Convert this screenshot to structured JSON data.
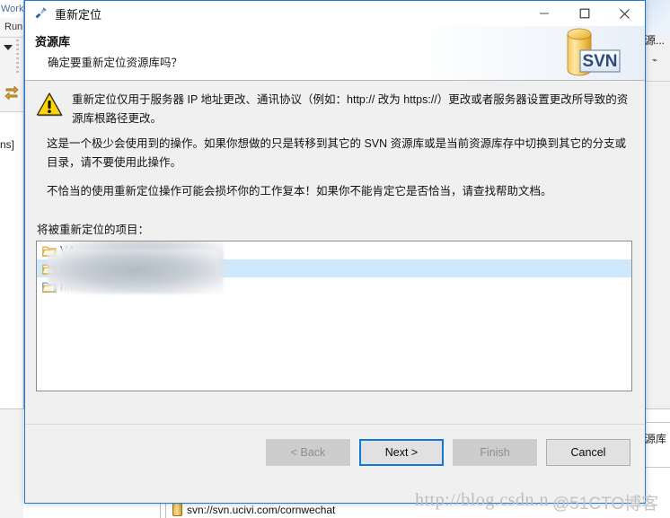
{
  "window": {
    "title": "重新定位",
    "title_icon": "relocate-icon",
    "controls": {
      "minimize": "—",
      "maximize": "□",
      "close": "✕"
    }
  },
  "header": {
    "title": "资源库",
    "subtitle": "确定要重新定位资源库吗？",
    "logo_text": "SVN",
    "logo_name": "svn-repository-logo"
  },
  "body": {
    "warning_icon": "warning-triangle-icon",
    "warning_text": "重新定位仅用于服务器 IP 地址更改、通讯协议（例如：http:// 改为 https://）更改或者服务器设置更改所导致的资源库根路径更改。",
    "paragraph_2": "这是一个极少会使用到的操作。如果你想做的只是转移到其它的 SVN 资源库或是当前资源库存中切换到其它的分支或目录，请不要使用此操作。",
    "paragraph_3": "不恰当的使用重新定位操作可能会损坏你的工作复本！如果你不能肯定它是否恰当，请查找帮助文档。"
  },
  "list": {
    "label": "将被重新定位的项目：",
    "items": [
      {
        "text": "V4",
        "selected": false,
        "icon": "folder-icon"
      },
      {
        "text": "Mas",
        "selected": true,
        "icon": "folder-icon"
      },
      {
        "text": "nMas",
        "selected": false,
        "icon": "folder-icon"
      }
    ]
  },
  "buttons": [
    {
      "label": "< Back",
      "state": "disabled",
      "name": "back-button"
    },
    {
      "label": "Next >",
      "state": "default",
      "name": "next-button"
    },
    {
      "label": "Finish",
      "state": "disabled",
      "name": "finish-button"
    },
    {
      "label": "Cancel",
      "state": "enabled",
      "name": "cancel-button"
    }
  ],
  "background": {
    "left_tab_top": "Work",
    "left_tab_bottom": "Run",
    "left_editor_text": "ns]",
    "sync_icon": "synchronize-icon",
    "right_label_top": "资源...",
    "right_label_bottom": "资源库",
    "tree_item": "svn://svn.ucivi.com/cornwechat",
    "tree_icon": "svn-repo-icon"
  },
  "watermarks": {
    "csdn": "http://blog.csdn.n",
    "cto": "@51CTO博客"
  },
  "colors": {
    "dialog_border": "#1e7ad6",
    "default_button_border": "#0d7ada",
    "selection": "#cfe8fb",
    "body_bg": "#f0f0f0",
    "warning_yellow": "#ffd400"
  }
}
